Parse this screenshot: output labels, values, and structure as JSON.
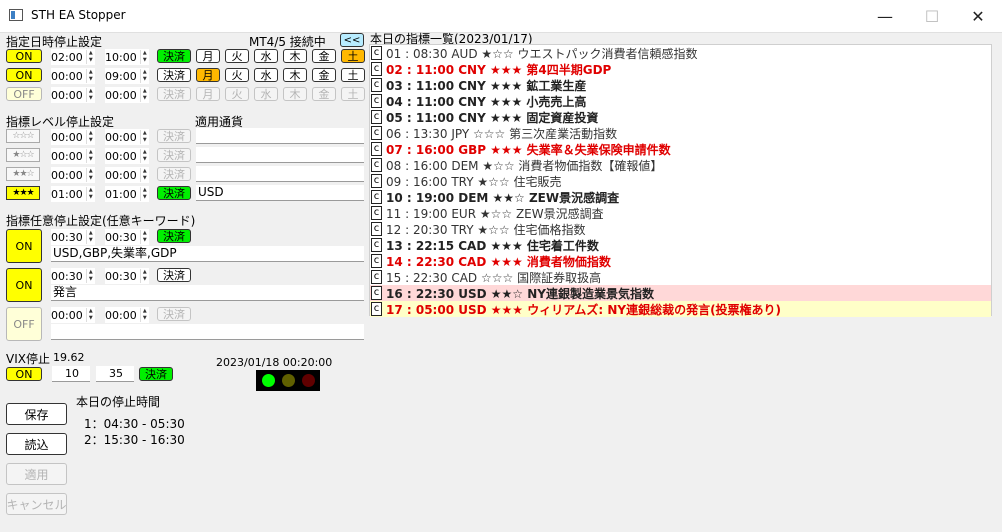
{
  "window": {
    "title": "STH EA Stopper",
    "minimize": "—",
    "maximize": "☐",
    "close": "✕"
  },
  "schedule": {
    "title": "指定日時停止設定",
    "connection": "MT4/5 接続中",
    "collapse_btn": "<<",
    "days": [
      "月",
      "火",
      "水",
      "木",
      "金",
      "土"
    ],
    "rows": [
      {
        "toggle": "ON",
        "from": "02:00",
        "to": "10:00",
        "settle": "決済",
        "active_days": [
          5
        ]
      },
      {
        "toggle": "ON",
        "from": "00:00",
        "to": "09:00",
        "settle": "決済",
        "active_days": [
          0
        ]
      },
      {
        "toggle": "OFF",
        "from": "00:00",
        "to": "00:00",
        "settle": "決済",
        "active_days": []
      }
    ]
  },
  "indicator_level": {
    "title": "指標レベル停止設定",
    "currency_label": "適用通貨",
    "rows": [
      {
        "stars": "☆☆☆",
        "from": "00:00",
        "to": "00:00",
        "settle": "決済",
        "currency": ""
      },
      {
        "stars": "★☆☆",
        "from": "00:00",
        "to": "00:00",
        "settle": "決済",
        "currency": ""
      },
      {
        "stars": "★★☆",
        "from": "00:00",
        "to": "00:00",
        "settle": "決済",
        "currency": ""
      },
      {
        "stars": "★★★",
        "from": "01:00",
        "to": "01:00",
        "settle": "決済",
        "currency": "USD"
      }
    ]
  },
  "keyword": {
    "title": "指標任意停止設定(任意キーワード)",
    "rows": [
      {
        "toggle": "ON",
        "from": "00:30",
        "to": "00:30",
        "settle": "決済",
        "keyword": "USD,GBP,失業率,GDP"
      },
      {
        "toggle": "ON",
        "from": "00:30",
        "to": "00:30",
        "settle": "決済",
        "keyword": "発言"
      },
      {
        "toggle": "OFF",
        "from": "00:00",
        "to": "00:00",
        "settle": "決済",
        "keyword": ""
      }
    ]
  },
  "vix": {
    "label": "VIX停止",
    "value": "19.62",
    "toggle": "ON",
    "low": "10",
    "high": "35",
    "settle": "決済"
  },
  "clock": {
    "datetime": "2023/01/18 00:20:00"
  },
  "lights": {
    "colors": [
      "#00ff00",
      "#606000",
      "#600000"
    ]
  },
  "today_stops": {
    "title": "本日の停止時間",
    "items": [
      "1：04:30 - 05:30",
      "2：15:30 - 16:30"
    ]
  },
  "actions": {
    "save": "保存",
    "load": "読込",
    "apply": "適用",
    "cancel": "キャンセル"
  },
  "indicator_list": {
    "title": "本日の指標一覧(2023/01/17)",
    "check_label": "c",
    "items": [
      {
        "text": "01 : 08:30 AUD ★☆☆ ウエストパック消費者信頼感指数",
        "style": "normal"
      },
      {
        "text": "02 : 11:00 CNY ★★★ 第4四半期GDP",
        "style": "red"
      },
      {
        "text": "03 : 11:00 CNY ★★★ 鉱工業生産",
        "style": "bold"
      },
      {
        "text": "04 : 11:00 CNY ★★★ 小売売上高",
        "style": "bold"
      },
      {
        "text": "05 : 11:00 CNY ★★★ 固定資産投資",
        "style": "bold"
      },
      {
        "text": "06 : 13:30 JPY ☆☆☆ 第三次産業活動指数",
        "style": "normal"
      },
      {
        "text": "07 : 16:00 GBP ★★★ 失業率＆失業保険申請件数",
        "style": "red"
      },
      {
        "text": "08 : 16:00 DEM ★☆☆ 消費者物価指数【確報値】",
        "style": "normal"
      },
      {
        "text": "09 : 16:00 TRY ★☆☆ 住宅販売",
        "style": "normal"
      },
      {
        "text": "10 : 19:00 DEM ★★☆ ZEW景況感調査",
        "style": "bold"
      },
      {
        "text": "11 : 19:00 EUR ★☆☆ ZEW景況感調査",
        "style": "normal"
      },
      {
        "text": "12 : 20:30 TRY ★☆☆ 住宅価格指数",
        "style": "normal"
      },
      {
        "text": "13 : 22:15 CAD ★★★ 住宅着工件数",
        "style": "bold"
      },
      {
        "text": "14 : 22:30 CAD ★★★ 消費者物価指数",
        "style": "red"
      },
      {
        "text": "15 : 22:30 CAD ☆☆☆ 国際証券取扱高",
        "style": "normal"
      },
      {
        "text": "16 : 22:30 USD ★★☆ NY連銀製造業景気指数",
        "style": "bold",
        "highlight": "#ffd8d8"
      },
      {
        "text": "17 : 05:00 USD ★★★ ウィリアムズ: NY連銀総裁の発言(投票権あり)",
        "style": "red",
        "highlight": "#ffffc8"
      }
    ]
  }
}
